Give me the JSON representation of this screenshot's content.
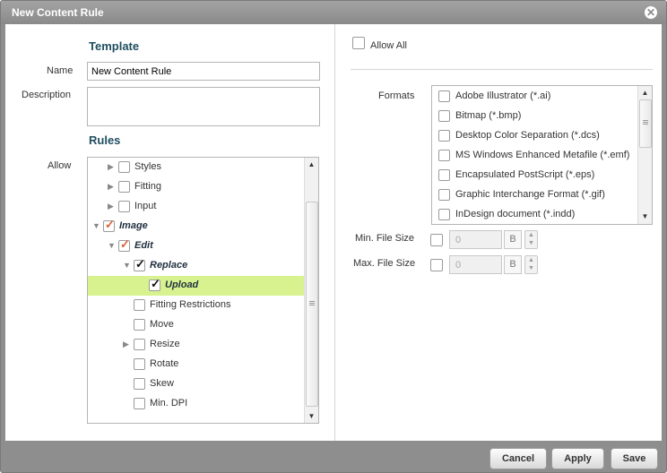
{
  "dialog": {
    "title": "New Content Rule"
  },
  "template": {
    "heading": "Template",
    "name_label": "Name",
    "name_value": "New Content Rule",
    "description_label": "Description",
    "description_value": ""
  },
  "rules": {
    "heading": "Rules",
    "allow_label": "Allow",
    "tree": [
      {
        "label": "Styles",
        "checked": false,
        "expander": "collapsed"
      },
      {
        "label": "Fitting",
        "checked": false,
        "expander": "collapsed"
      },
      {
        "label": "Input",
        "checked": false,
        "expander": "collapsed"
      },
      {
        "label": "Image",
        "checked": "partial",
        "expander": "expanded"
      },
      {
        "label": "Edit",
        "checked": "partial",
        "expander": "expanded"
      },
      {
        "label": "Replace",
        "checked": true,
        "expander": "expanded"
      },
      {
        "label": "Upload",
        "checked": true,
        "expander": "none",
        "selected": true
      },
      {
        "label": "Fitting Restrictions",
        "checked": false,
        "expander": "none"
      },
      {
        "label": "Move",
        "checked": false,
        "expander": "none"
      },
      {
        "label": "Resize",
        "checked": false,
        "expander": "collapsed"
      },
      {
        "label": "Rotate",
        "checked": false,
        "expander": "none"
      },
      {
        "label": "Skew",
        "checked": false,
        "expander": "none"
      },
      {
        "label": "Min. DPI",
        "checked": false,
        "expander": "none"
      }
    ]
  },
  "right": {
    "allow_all_label": "Allow All",
    "formats_label": "Formats",
    "formats": [
      "Adobe Illustrator (*.ai)",
      "Bitmap (*.bmp)",
      "Desktop Color Separation (*.dcs)",
      "MS Windows Enhanced Metafile (*.emf)",
      "Encapsulated PostScript (*.eps)",
      "Graphic Interchange Format (*.gif)",
      "InDesign document (*.indd)"
    ],
    "min_size_label": "Min. File Size",
    "min_size_value": "0",
    "max_size_label": "Max. File Size",
    "max_size_value": "0",
    "unit": "B"
  },
  "buttons": {
    "cancel": "Cancel",
    "apply": "Apply",
    "save": "Save"
  },
  "colors": {
    "title_bar": "#8e8e8e",
    "selection": "#d7f28f",
    "heading": "#1f4e5f",
    "partial_check": "#d9633b"
  },
  "icons": {
    "close": "close-icon",
    "expander_collapsed": "triangle-right-icon",
    "expander_expanded": "triangle-down-icon"
  }
}
